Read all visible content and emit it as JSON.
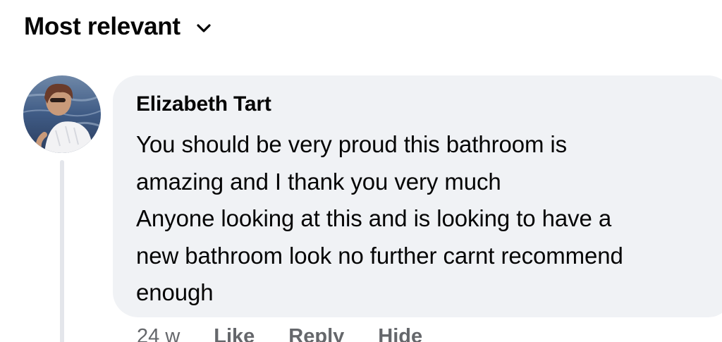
{
  "sort": {
    "label": "Most relevant",
    "icon": "chevron-down-icon"
  },
  "comment": {
    "author": "Elizabeth Tart",
    "text_lines": [
      "You should be very proud this bathroom is",
      "amazing and I thank you very much",
      "Anyone looking at this and is looking to have a",
      "new bathroom look no further carnt recommend",
      "enough"
    ],
    "timestamp": "24 w",
    "actions": {
      "like": "Like",
      "reply": "Reply",
      "hide": "Hide"
    }
  },
  "colors": {
    "bubble": "#f0f2f5",
    "meta_text": "#65676b",
    "thread_line": "#e4e6eb"
  }
}
